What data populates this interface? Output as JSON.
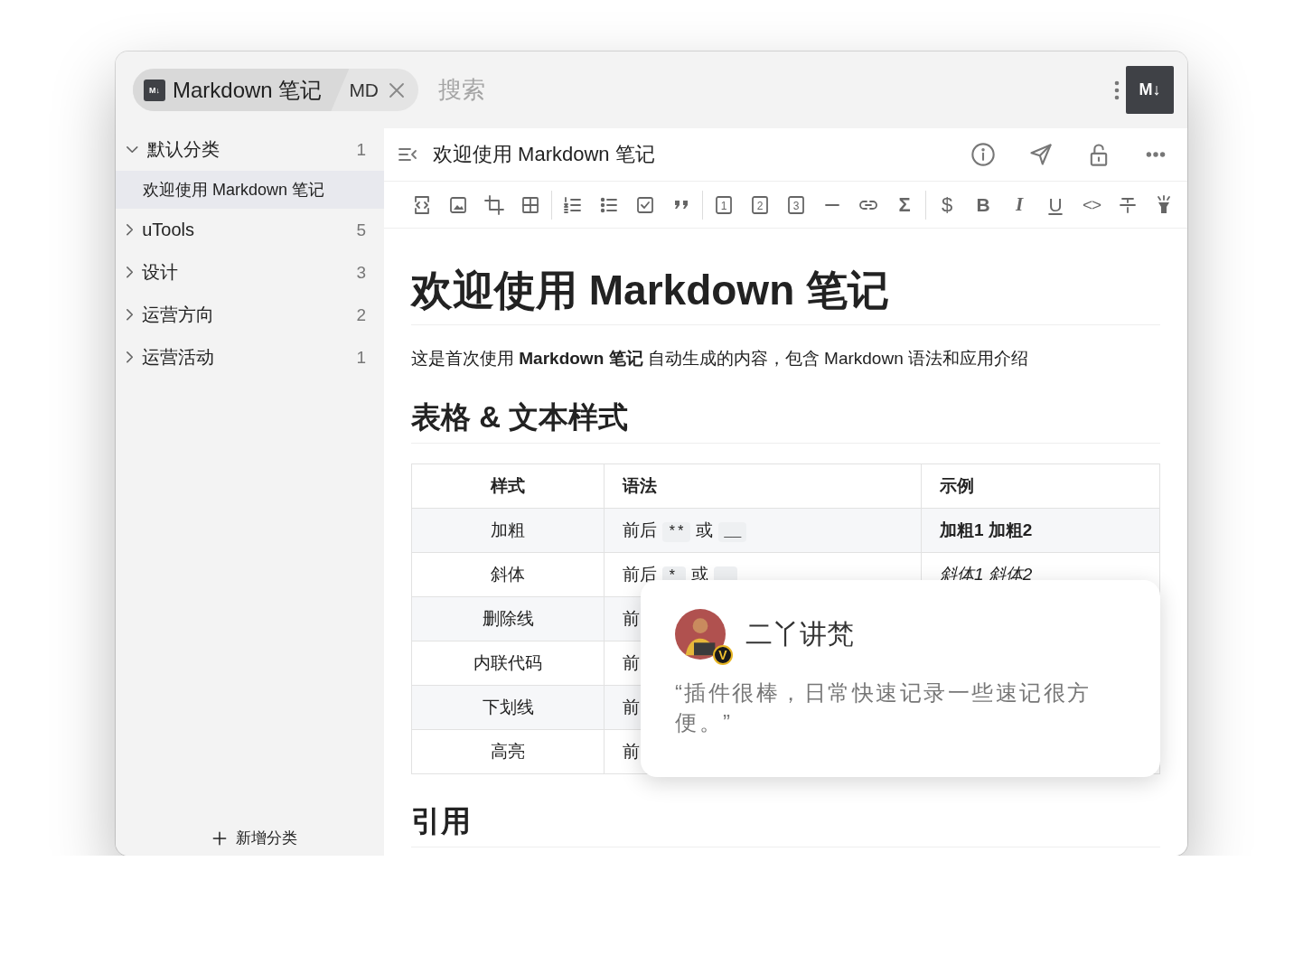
{
  "topbar": {
    "tab": {
      "logo": "M↓",
      "label": "Markdown 笔记",
      "selected": true
    },
    "mode": "MD",
    "search": {
      "placeholder": "搜索"
    },
    "logo": "M↓"
  },
  "sidebar": {
    "categories": [
      {
        "name": "默认分类",
        "count": "1",
        "expanded": true,
        "children": [
          {
            "name": "欢迎使用 Markdown 笔记",
            "selected": true
          }
        ]
      },
      {
        "name": "uTools",
        "count": "5",
        "expanded": false
      },
      {
        "name": "设计",
        "count": "3",
        "expanded": false
      },
      {
        "name": "运营方向",
        "count": "2",
        "expanded": false
      },
      {
        "name": "运营活动",
        "count": "1",
        "expanded": false
      }
    ],
    "add_button": "新增分类"
  },
  "editor": {
    "title": "欢迎使用 Markdown 笔记",
    "toolbar": [
      [
        {
          "kind": "code-block"
        },
        {
          "kind": "image"
        },
        {
          "kind": "crop"
        },
        {
          "kind": "table"
        }
      ],
      [
        {
          "kind": "ordered-list"
        },
        {
          "kind": "bullet-list"
        },
        {
          "kind": "task-list"
        },
        {
          "kind": "quote"
        }
      ],
      [
        {
          "kind": "heading",
          "label": "1"
        },
        {
          "kind": "heading",
          "label": "2"
        },
        {
          "kind": "heading",
          "label": "3"
        },
        {
          "kind": "rule"
        },
        {
          "kind": "link"
        },
        {
          "kind": "sum",
          "label": "Σ"
        }
      ],
      [
        {
          "kind": "math",
          "label": "$"
        },
        {
          "kind": "bold",
          "label": "B"
        },
        {
          "kind": "italic",
          "label": "I"
        },
        {
          "kind": "underline",
          "label": "U"
        },
        {
          "kind": "code",
          "label": "<>"
        },
        {
          "kind": "strikethrough"
        },
        {
          "kind": "flashlight"
        }
      ]
    ],
    "heading": "欢迎使用 Markdown 笔记",
    "intro": "这是首次使用 **Markdown 笔记** 自动生成的内容，包含 Markdown 语法和应用介绍",
    "section": "表格 & 文本样式",
    "table": {
      "columns": [
        "样式",
        "语法",
        "示例"
      ],
      "rows": [
        {
          "style": "加粗",
          "syntax": [
            {
              "kind": "text",
              "text": "前后"
            },
            {
              "kind": "code",
              "text": "**"
            },
            {
              "kind": "text",
              "text": "或"
            },
            {
              "kind": "code",
              "text": "__"
            }
          ],
          "example": {
            "text": "加粗1 加粗2",
            "kind": "bold"
          }
        },
        {
          "style": "斜体",
          "syntax": [
            {
              "kind": "text",
              "text": "前后"
            },
            {
              "kind": "code",
              "text": "*"
            },
            {
              "kind": "text",
              "text": "或"
            },
            {
              "kind": "code-cut"
            }
          ],
          "example": {
            "text": "斜体1 斜体2",
            "kind": "italic"
          }
        },
        {
          "style": "删除线",
          "syntax": [
            {
              "kind": "text",
              "text": "前"
            }
          ]
        },
        {
          "style": "内联代码",
          "syntax": [
            {
              "kind": "text",
              "text": "前"
            }
          ]
        },
        {
          "style": "下划线",
          "syntax": [
            {
              "kind": "text",
              "text": "前"
            }
          ]
        },
        {
          "style": "高亮",
          "syntax": [
            {
              "kind": "text",
              "text": "前"
            }
          ]
        }
      ]
    },
    "section2": "引用"
  },
  "review": {
    "name": "二丫讲梵",
    "badge": "V",
    "quote": "“插件很棒，日常快速记录一些速记很方便。”"
  }
}
